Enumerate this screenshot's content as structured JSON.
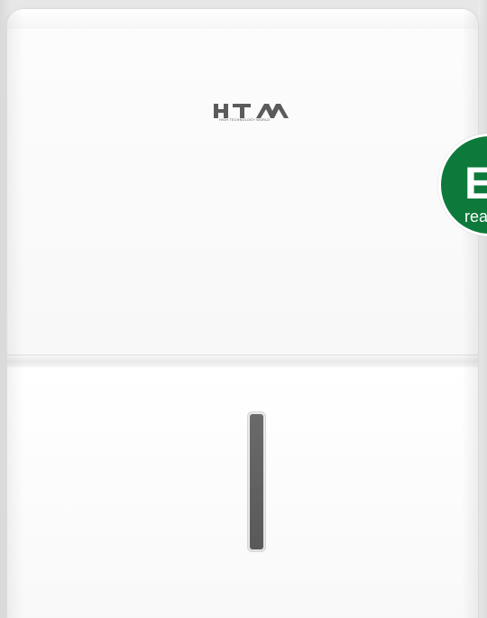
{
  "product": {
    "brand_logo": "HTW",
    "brand_subtitle": "HIGH TECHNOLOGY WORLD",
    "badge_big": "E",
    "badge_small": "rea"
  },
  "colors": {
    "body": "#ffffff",
    "badge": "#0d7a3c",
    "window": "#595959",
    "background": "#ececec"
  }
}
